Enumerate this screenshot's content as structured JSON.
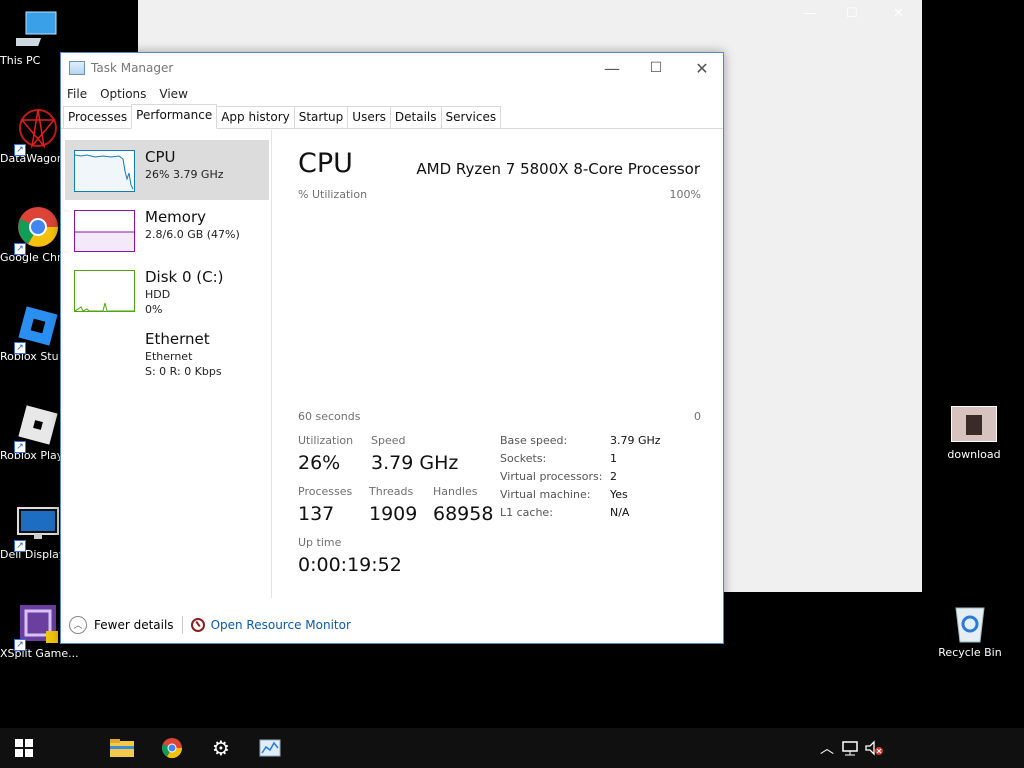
{
  "desktop": {
    "icons_left": [
      {
        "label": "This PC",
        "icon": "this-pc-icon"
      },
      {
        "label": "DataWagon",
        "icon": "datawagon-icon"
      },
      {
        "label": "Google Chr",
        "icon": "chrome-icon"
      },
      {
        "label": "Roblox Stu",
        "icon": "roblox-studio-icon"
      },
      {
        "label": "Roblox Play",
        "icon": "roblox-player-icon"
      },
      {
        "label": "Dell Display",
        "icon": "dell-display-icon"
      },
      {
        "label": "XSplit Game...",
        "icon": "xsplit-icon"
      }
    ],
    "icons_right": [
      {
        "label": "download",
        "icon": "image-file-icon"
      },
      {
        "label": "Recycle Bin",
        "icon": "recycle-bin-icon"
      }
    ]
  },
  "task_manager": {
    "title": "Task Manager",
    "menu": [
      "File",
      "Options",
      "View"
    ],
    "tabs": [
      "Processes",
      "Performance",
      "App history",
      "Startup",
      "Users",
      "Details",
      "Services"
    ],
    "active_tab": "Performance",
    "sidebar": [
      {
        "name": "CPU",
        "line1": "26% 3.79 GHz",
        "line2": ""
      },
      {
        "name": "Memory",
        "line1": "2.8/6.0 GB (47%)",
        "line2": ""
      },
      {
        "name": "Disk 0 (C:)",
        "line1": "HDD",
        "line2": "0%"
      },
      {
        "name": "Ethernet",
        "line1": "Ethernet",
        "line2": "S: 0 R: 0 Kbps"
      }
    ],
    "cpu": {
      "title": "CPU",
      "model": "AMD Ryzen 7 5800X 8-Core Processor",
      "utilization_label": "% Utilization",
      "max_label": "100%",
      "time_label": "60 seconds",
      "min_label": "0",
      "stats": {
        "utilization_label": "Utilization",
        "utilization": "26%",
        "speed_label": "Speed",
        "speed": "3.79 GHz",
        "processes_label": "Processes",
        "processes": "137",
        "threads_label": "Threads",
        "threads": "1909",
        "handles_label": "Handles",
        "handles": "68958",
        "uptime_label": "Up time",
        "uptime": "0:00:19:52"
      },
      "specs": [
        {
          "k": "Base speed:",
          "v": "3.79 GHz"
        },
        {
          "k": "Sockets:",
          "v": "1"
        },
        {
          "k": "Virtual processors:",
          "v": "2"
        },
        {
          "k": "Virtual machine:",
          "v": "Yes"
        },
        {
          "k": "L1 cache:",
          "v": "N/A"
        }
      ]
    },
    "footer": {
      "fewer_details": "Fewer details",
      "open_resource_monitor": "Open Resource Monitor"
    }
  },
  "colors": {
    "cpu_graph": "#117dbb",
    "memory_graph": "#8b12ae",
    "disk_graph": "#4da60c",
    "link": "#0b5aa8"
  }
}
